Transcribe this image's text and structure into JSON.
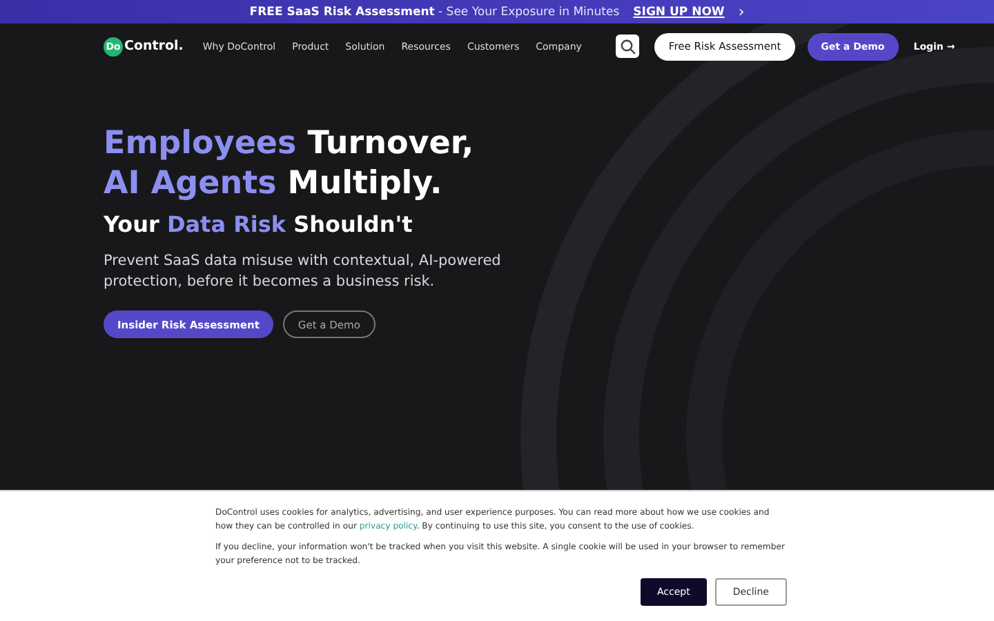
{
  "banner": {
    "strong": "FREE SaaS Risk Assessment",
    "rest": " - See Your Exposure in Minutes",
    "link": "SIGN UP NOW",
    "arrow": "›"
  },
  "nav": {
    "logo": {
      "badge": "Do",
      "text": "Control."
    },
    "items": [
      "Why DoControl",
      "Product",
      "Solution",
      "Resources",
      "Customers",
      "Company"
    ],
    "cta_secondary": "Free Risk Assessment",
    "cta_primary": "Get a Demo",
    "login": "Login",
    "login_arrow": "→"
  },
  "hero": {
    "headline": [
      [
        {
          "text": "Employees",
          "accent": true
        },
        {
          "text": " Turnover,",
          "accent": false
        }
      ],
      [
        {
          "text": "AI Agents",
          "accent": true
        },
        {
          "text": " Multiply.",
          "accent": false
        }
      ]
    ],
    "subhead": [
      {
        "text": "Your ",
        "accent": false
      },
      {
        "text": "Data Risk",
        "accent": true
      },
      {
        "text": " Shouldn't",
        "accent": false
      }
    ],
    "description": "Prevent SaaS data misuse with contextual, AI-powered protection, before it becomes a business risk.",
    "buttons": [
      {
        "label": "Insider Risk Assessment",
        "kind": "primary"
      },
      {
        "label": "Get a Demo",
        "kind": "outline"
      }
    ]
  },
  "cookie_banner": {
    "paragraph_1": {
      "before": "DoControl uses cookies for analytics, advertising, and user experience purposes. You can read more about how we use cookies and how they can be controlled in our ",
      "link": "privacy policy",
      "after": ". By continuing to use this site, you consent to the use of cookies."
    },
    "paragraph_2": "If you decline, your information won't be tracked when you visit this website. A single cookie will be used in your browser to remember your preference not to be tracked.",
    "buttons": [
      {
        "label": "Accept",
        "kind": "primary"
      },
      {
        "label": "Decline",
        "kind": "outline"
      }
    ]
  }
}
